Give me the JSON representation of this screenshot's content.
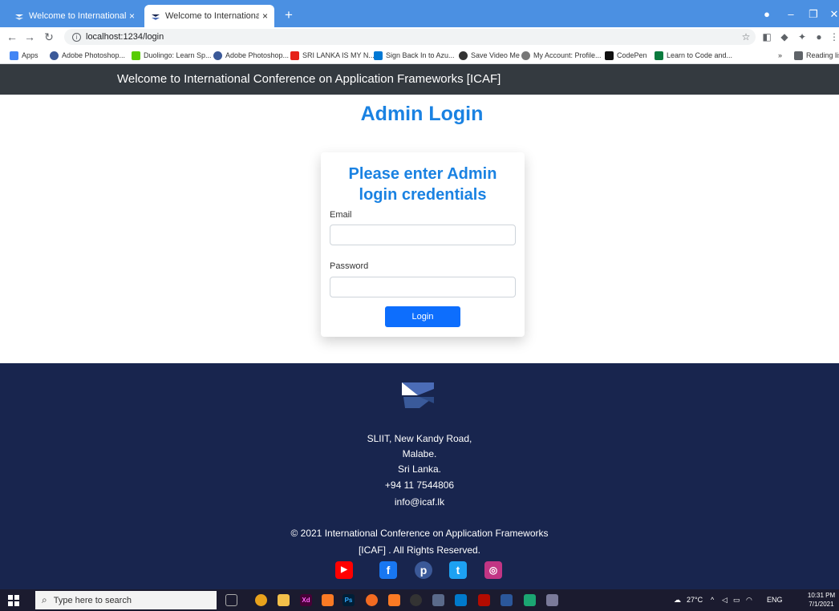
{
  "browser": {
    "tabs": [
      {
        "label": "Welcome to International Confe",
        "close": "×"
      },
      {
        "label": "Welcome to International Confe",
        "close": "×"
      }
    ],
    "new_tab": "+",
    "url": "localhost:1234/login",
    "bookmarks": [
      {
        "label": "Apps",
        "color": "#ea4335"
      },
      {
        "label": "Adobe Photoshop...",
        "color": "#3b5998"
      },
      {
        "label": "Duolingo: Learn Sp...",
        "color": "#58cc02"
      },
      {
        "label": "Adobe Photoshop...",
        "color": "#3b5998"
      },
      {
        "label": "SRI LANKA IS MY N...",
        "color": "#e62117"
      },
      {
        "label": "Sign Back In to Azu...",
        "color": "#0078d4"
      },
      {
        "label": "Save Video Me",
        "color": "#333333"
      },
      {
        "label": "My Account: Profile...",
        "color": "#777777"
      },
      {
        "label": "CodePen",
        "color": "#111111"
      },
      {
        "label": "Learn to Code and...",
        "color": "#0a7b3e"
      }
    ],
    "bookmarks_more": "»",
    "reading_list": "Reading list"
  },
  "header": {
    "title": "Welcome to International Conference on Application Frameworks [ICAF]"
  },
  "main": {
    "heading": "Admin Login",
    "card": {
      "heading_line1": "Please enter Admin",
      "heading_line2": "login credentials",
      "email_label": "Email",
      "email_value": "",
      "password_label": "Password",
      "password_value": "",
      "login_label": "Login"
    }
  },
  "footer": {
    "address_line1": "SLIIT, New Kandy Road,",
    "address_line2": "Malabe.",
    "address_line3": "Sri Lanka.",
    "phone": "+94 11 7544806",
    "email": "info@icaf.lk",
    "copyright_line1": "© 2021 International Conference on Application Frameworks",
    "copyright_line2": "[ICAF] . All Rights Reserved.",
    "social": [
      {
        "name": "youtube",
        "color": "#ff0000"
      },
      {
        "name": "facebook",
        "color": "#1877f2"
      },
      {
        "name": "pinterest",
        "color": "#3b5998"
      },
      {
        "name": "twitter",
        "color": "#1da1f2"
      },
      {
        "name": "instagram",
        "color": "#c13584"
      }
    ]
  },
  "taskbar": {
    "search_placeholder": "Type here to search",
    "weather": "27°C",
    "lang": "ENG",
    "time": "10:31 PM",
    "date": "7/1/2021"
  }
}
